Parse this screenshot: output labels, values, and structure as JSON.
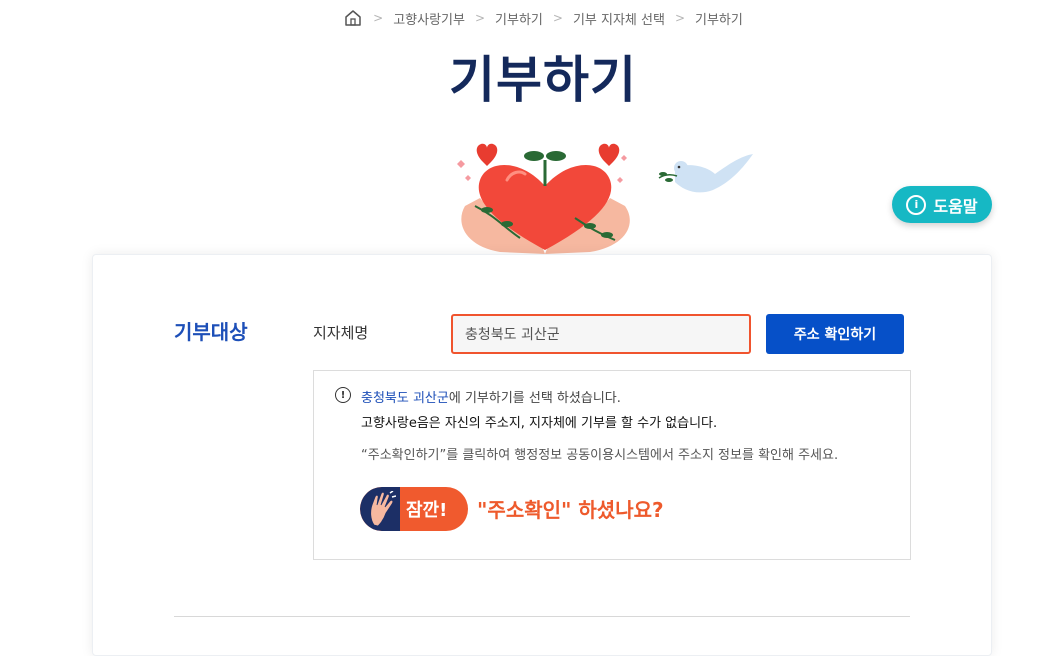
{
  "breadcrumb": {
    "items": [
      "고향사랑기부",
      "기부하기",
      "기부 지자체 선택",
      "기부하기"
    ]
  },
  "page": {
    "title": "기부하기"
  },
  "help": {
    "label": "도움말"
  },
  "form": {
    "section_title": "기부대상",
    "field_label": "지자체명",
    "region_value": "충청북도 괴산군",
    "confirm_button": "주소 확인하기"
  },
  "notice": {
    "line1_highlight": "충청북도 괴산군",
    "line1_rest": "에 기부하기를 선택 하셨습니다.",
    "line2": "고향사랑e음은 자신의 주소지, 지자체에 기부를 할 수가 없습니다.",
    "line3": "“주소확인하기”를 클릭하여 행정정보 공동이용시스템에서 주소지 정보를 확인해 주세요.",
    "wait_label": "잠깐!",
    "prompt": "\"주소확인\" 하셨나요?"
  },
  "colors": {
    "title": "#14295b",
    "accent_blue": "#0650c8",
    "accent_orange": "#f05a2e",
    "help_teal": "#16b8c4"
  },
  "icons": [
    "home-icon",
    "info-icon",
    "alert-icon",
    "hand-icon",
    "heart-illustration",
    "dove-illustration"
  ]
}
